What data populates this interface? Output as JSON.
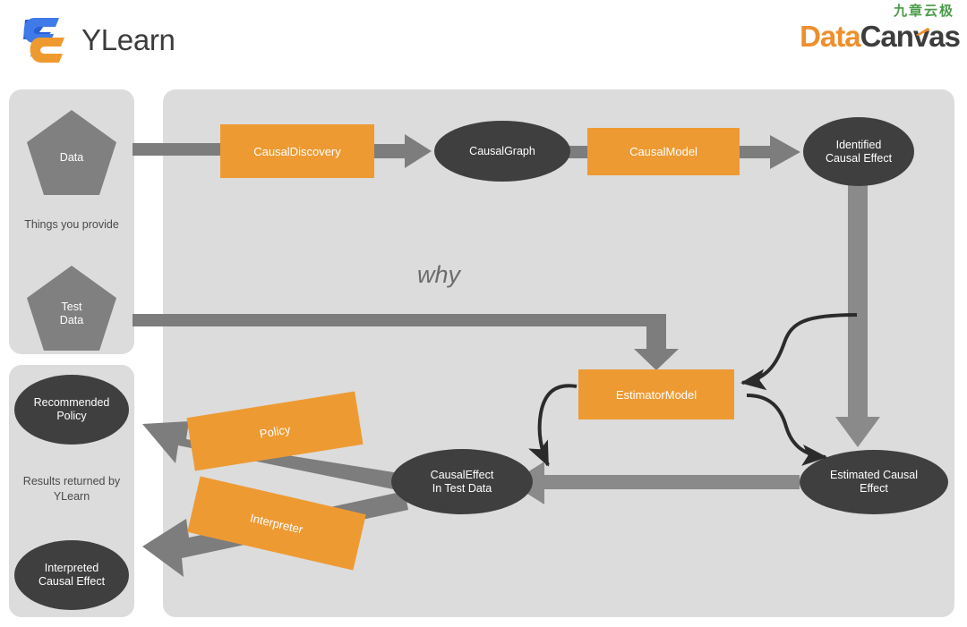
{
  "header": {
    "ylearn": {
      "name": "YLearn",
      "mark_icon": "ylearn-logo-icon"
    },
    "datacanvas": {
      "chinese": "九章云极",
      "word_a": "Data",
      "word_b": "Canvas",
      "accent": "#ee8f2d",
      "dark": "#3d3d3d",
      "green": "#4a9b4a"
    }
  },
  "panels": {
    "provide_label": "Things you provide",
    "results_label": "Results returned by\nYLearn",
    "results_label_line1": "Results returned by",
    "results_label_line2": "YLearn"
  },
  "center_annotation": "why",
  "nodes": {
    "data": {
      "label": "Data",
      "shape": "pentagon",
      "color": "#808080"
    },
    "test_data_l1": "Test",
    "test_data_l2": "Data",
    "causal_discovery": {
      "label": "CausalDiscovery",
      "shape": "rect",
      "color": "#ee9a33"
    },
    "causal_graph": {
      "label": "CausalGraph",
      "shape": "ellipse",
      "color": "#3f3f3f"
    },
    "causal_model": {
      "label": "CausalModel",
      "shape": "rect",
      "color": "#ee9a33"
    },
    "identified_l1": "Identified",
    "identified_l2": "Causal Effect",
    "estimator_model": {
      "label": "EstimatorModel",
      "shape": "rect",
      "color": "#ee9a33"
    },
    "estimated_l1": "Estimated Causal",
    "estimated_l2": "Effect",
    "causal_effect_td_l1": "CausalEffect",
    "causal_effect_td_l2": "In Test Data",
    "policy": {
      "label": "Policy",
      "shape": "rect",
      "color": "#ee9a33"
    },
    "interpreter": {
      "label": "Interpreter",
      "shape": "rect",
      "color": "#ee9a33"
    },
    "recommended_l1": "Recommended",
    "recommended_l2": "Policy",
    "interpreted_l1": "Interpreted",
    "interpreted_l2": "Causal Effect"
  },
  "colors": {
    "panel_bg": "#dcdcdc",
    "arrow_gray": "#7d7d7d",
    "arrow_dark": "#2b2b2b",
    "node_dark": "#3f3f3f",
    "node_gray": "#808080",
    "orange": "#ee9a33",
    "page_bg": "#ffffff"
  }
}
